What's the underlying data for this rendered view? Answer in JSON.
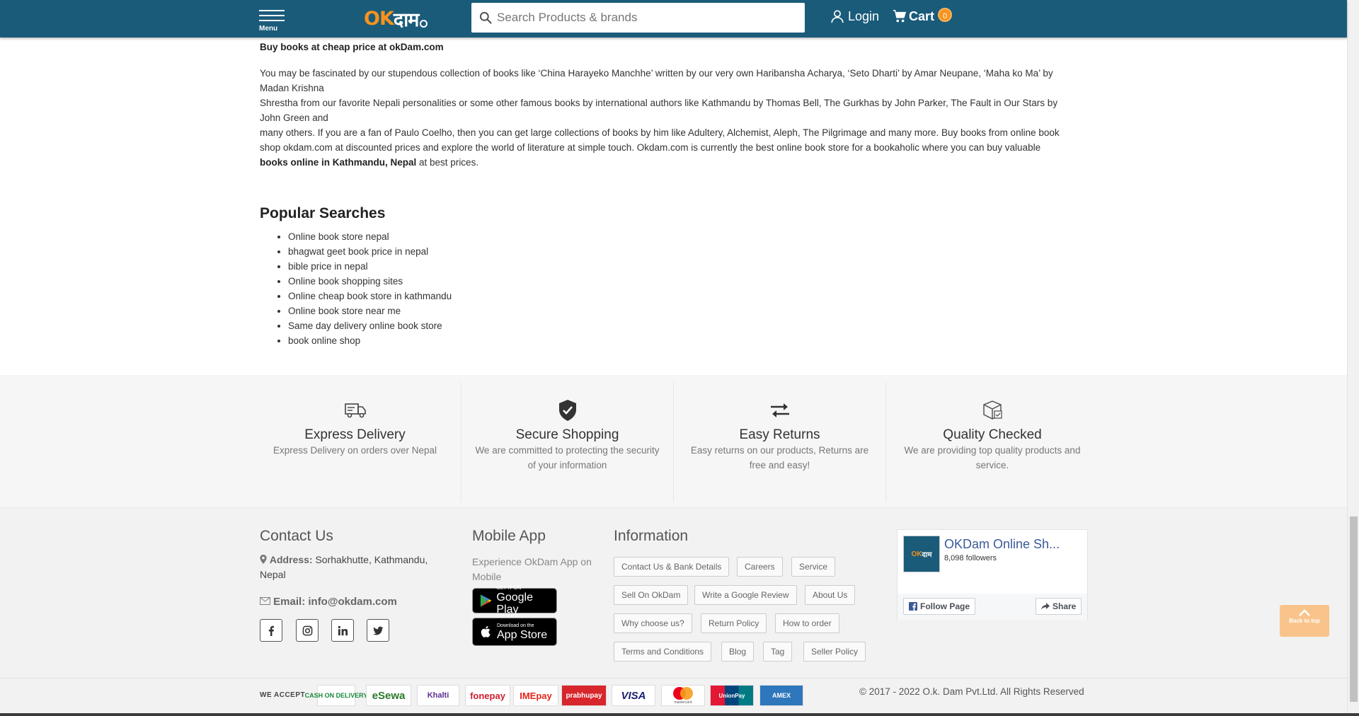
{
  "header": {
    "menu_label": "Menu",
    "logo_ok": "OK",
    "logo_dam": "दाम",
    "search_placeholder": "Search Products & brands",
    "login_label": "Login",
    "cart_label": "Cart",
    "cart_count": "0",
    "bg_color": "#1a5b7a",
    "accent_color": "#f7931e"
  },
  "content": {
    "lead": "Buy books at cheap price at okDam.com",
    "line1": "You may be fascinated by our stupendous collection of books like ‘China Harayeko Manchhe’ written by our very own Haribansha Acharya, ‘Seto Dharti’ by Amar Neupane, ‘Maha ko Ma’ by",
    "line2": "Madan Krishna",
    "line3": "Shrestha from our favorite Nepali personalities or some other famous books by international authors like Kathmandu by Thomas Bell, The Gurkhas by John Parker, The Fault in Our Stars by",
    "line4": "John Green and",
    "line5": "many others. If you are a fan of Paulo Coelho, then you can get large collections of books by him like Adultery, Alchemist, Aleph, The Pilgrimage and many more. Buy books from online book",
    "line6": "shop okdam.com at discounted prices and explore the world of literature at simple touch. Okdam.com is currently the best online book store for a bookaholic where you can buy valuable",
    "line7_bold": "books online in Kathmandu, Nepal",
    "line7_rest": " at best prices."
  },
  "popular": {
    "title": "Popular Searches",
    "items": [
      "Online book store nepal",
      "bhagwat geet book price in nepal",
      "bible price in nepal",
      "Online book shopping sites",
      "Online cheap book store in kathmandu",
      "Online book store near me",
      "Same day delivery online book store",
      "book online shop"
    ]
  },
  "features": [
    {
      "icon": "delivery-truck-icon",
      "title": "Express Delivery",
      "desc": "Express Delivery on orders over Nepal"
    },
    {
      "icon": "shield-check-icon",
      "title": "Secure Shopping",
      "desc": "We are committed to protecting the security of your information"
    },
    {
      "icon": "swap-arrows-icon",
      "title": "Easy Returns",
      "desc": "Easy returns on our products, Returns are free and easy!"
    },
    {
      "icon": "box-check-icon",
      "title": "Quality Checked",
      "desc": "We are providing top quality products and service."
    }
  ],
  "contact": {
    "title": "Contact Us",
    "address_label": "Address:",
    "address_value": "Sorhakhutte, Kathmandu,",
    "address_value2": "Nepal",
    "email_label": "Email:",
    "email_value": "info@okdam.com",
    "social": [
      "facebook-icon",
      "instagram-icon",
      "linkedin-icon",
      "twitter-icon"
    ]
  },
  "mobile_app": {
    "title": "Mobile App",
    "desc": "Experience OkDam App on Mobile",
    "google_small": "GET IT ON",
    "google_big": "Google Play",
    "apple_small": "Download on the",
    "apple_big": "App Store"
  },
  "information": {
    "title": "Information",
    "tags": [
      "Contact Us & Bank Details",
      "Careers",
      "Service",
      "Sell On OkDam",
      "Write a Google Review",
      "About Us",
      "Why choose us?",
      "Return Policy",
      "How to order",
      "Terms and Conditions",
      "Blog",
      "Tag",
      "Seller Policy"
    ]
  },
  "facebook": {
    "page_name": "OKDam Online Sh...",
    "followers": "8,098 followers",
    "follow_label": "Follow Page",
    "share_label": "Share",
    "thumb_ok": "OK",
    "thumb_dam": "दाम"
  },
  "back_to_top": "Back to top",
  "payments": {
    "label": "WE ACCEPT",
    "methods": [
      "CASH ON DELIVERY",
      "eSewa",
      "Khalti",
      "fonepay",
      "IMEpay",
      "prabhupay",
      "VISA",
      "mastercard",
      "UnionPay",
      "AMEX"
    ]
  },
  "copyright": "© 2017 - 2022 O.k. Dam Pvt.Ltd. All Rights Reserved"
}
